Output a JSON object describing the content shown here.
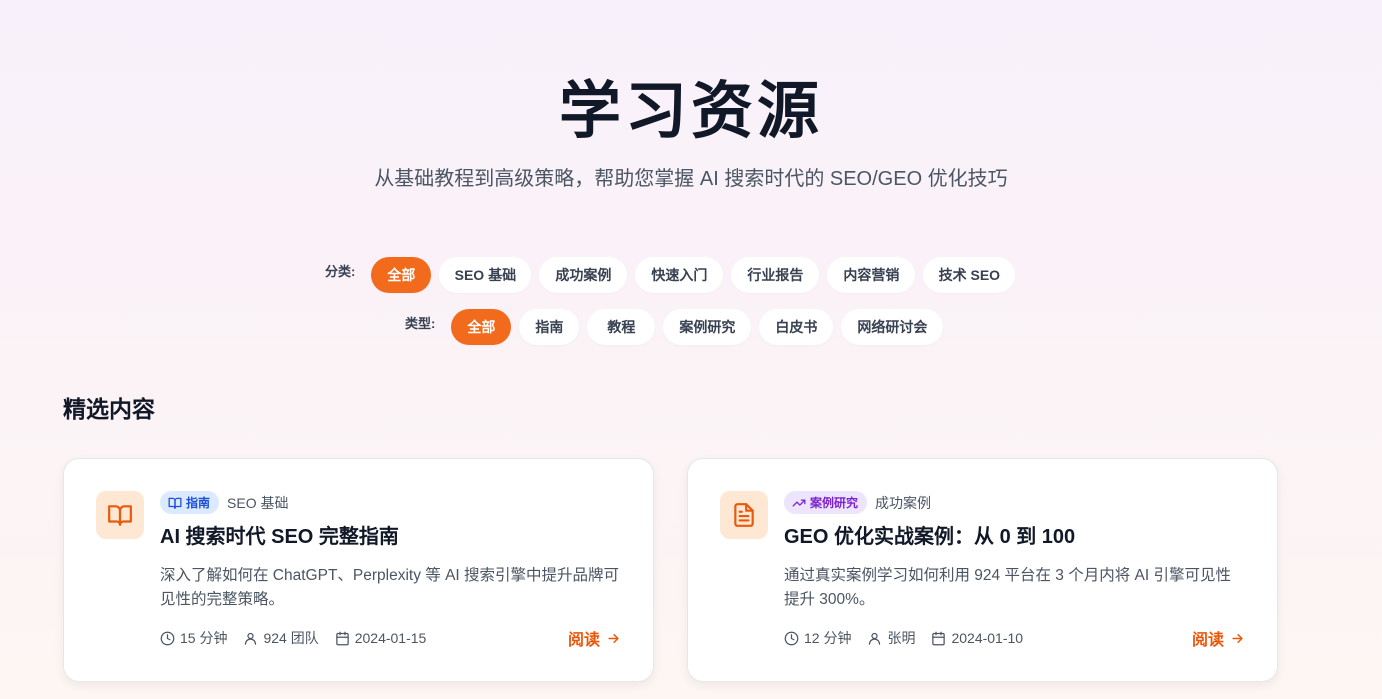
{
  "hero": {
    "title": "学习资源",
    "subtitle": "从基础教程到高级策略，帮助您掌握 AI 搜索时代的 SEO/GEO 优化技巧"
  },
  "filters": {
    "category_label": "分类:",
    "categories": [
      "全部",
      "SEO 基础",
      "成功案例",
      "快速入门",
      "行业报告",
      "内容营销",
      "技术 SEO"
    ],
    "category_active": "全部",
    "type_label": "类型:",
    "types": [
      "全部",
      "指南",
      "教程",
      "案例研究",
      "白皮书",
      "网络研讨会"
    ],
    "type_active": "全部"
  },
  "featured": {
    "title": "精选内容",
    "cards": [
      {
        "icon": "book-open-icon",
        "type_label": "指南",
        "type_icon": "book-open-icon",
        "category": "SEO 基础",
        "title": "AI 搜索时代 SEO 完整指南",
        "description": "深入了解如何在 ChatGPT、Perplexity 等 AI 搜索引擎中提升品牌可见性的完整策略。",
        "read_time": "15 分钟",
        "author": "924 团队",
        "date": "2024-01-15",
        "read_label": "阅读"
      },
      {
        "icon": "file-text-icon",
        "type_label": "案例研究",
        "type_icon": "trending-up-icon",
        "category": "成功案例",
        "title": "GEO 优化实战案例：从 0 到 100",
        "description": "通过真实案例学习如何利用 924 平台在 3 个月内将 AI 引擎可见性提升 300%。",
        "read_time": "12 分钟",
        "author": "张明",
        "date": "2024-01-10",
        "read_label": "阅读"
      }
    ]
  },
  "colors": {
    "accent": "#f26a1b",
    "link": "#ea580c",
    "badge_blue_bg": "#dbeafe",
    "badge_blue_text": "#1d4ed8",
    "badge_purple_bg": "#ede4fd",
    "badge_purple_text": "#7e22ce"
  }
}
